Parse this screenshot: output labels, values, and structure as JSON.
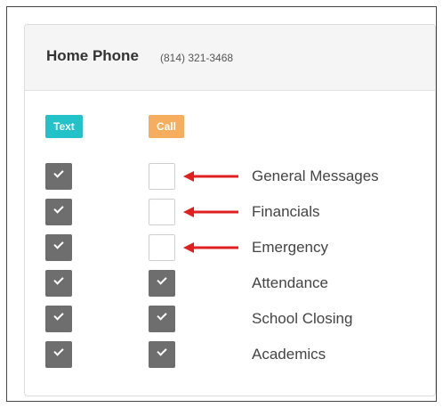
{
  "header": {
    "title": "Home Phone",
    "phone": "(814) 321-3468"
  },
  "columns": {
    "text_label": "Text",
    "call_label": "Call"
  },
  "colors": {
    "text_badge": "#22c2c8",
    "call_badge": "#f7ad5e",
    "checked_box": "#6e6e6e",
    "arrow": "#e02020"
  },
  "rows": [
    {
      "label": "General Messages",
      "text_checked": true,
      "call_checked": false,
      "arrow": true
    },
    {
      "label": "Financials",
      "text_checked": true,
      "call_checked": false,
      "arrow": true
    },
    {
      "label": "Emergency",
      "text_checked": true,
      "call_checked": false,
      "arrow": true
    },
    {
      "label": "Attendance",
      "text_checked": true,
      "call_checked": true,
      "arrow": false
    },
    {
      "label": "School Closing",
      "text_checked": true,
      "call_checked": true,
      "arrow": false
    },
    {
      "label": "Academics",
      "text_checked": true,
      "call_checked": true,
      "arrow": false
    }
  ]
}
